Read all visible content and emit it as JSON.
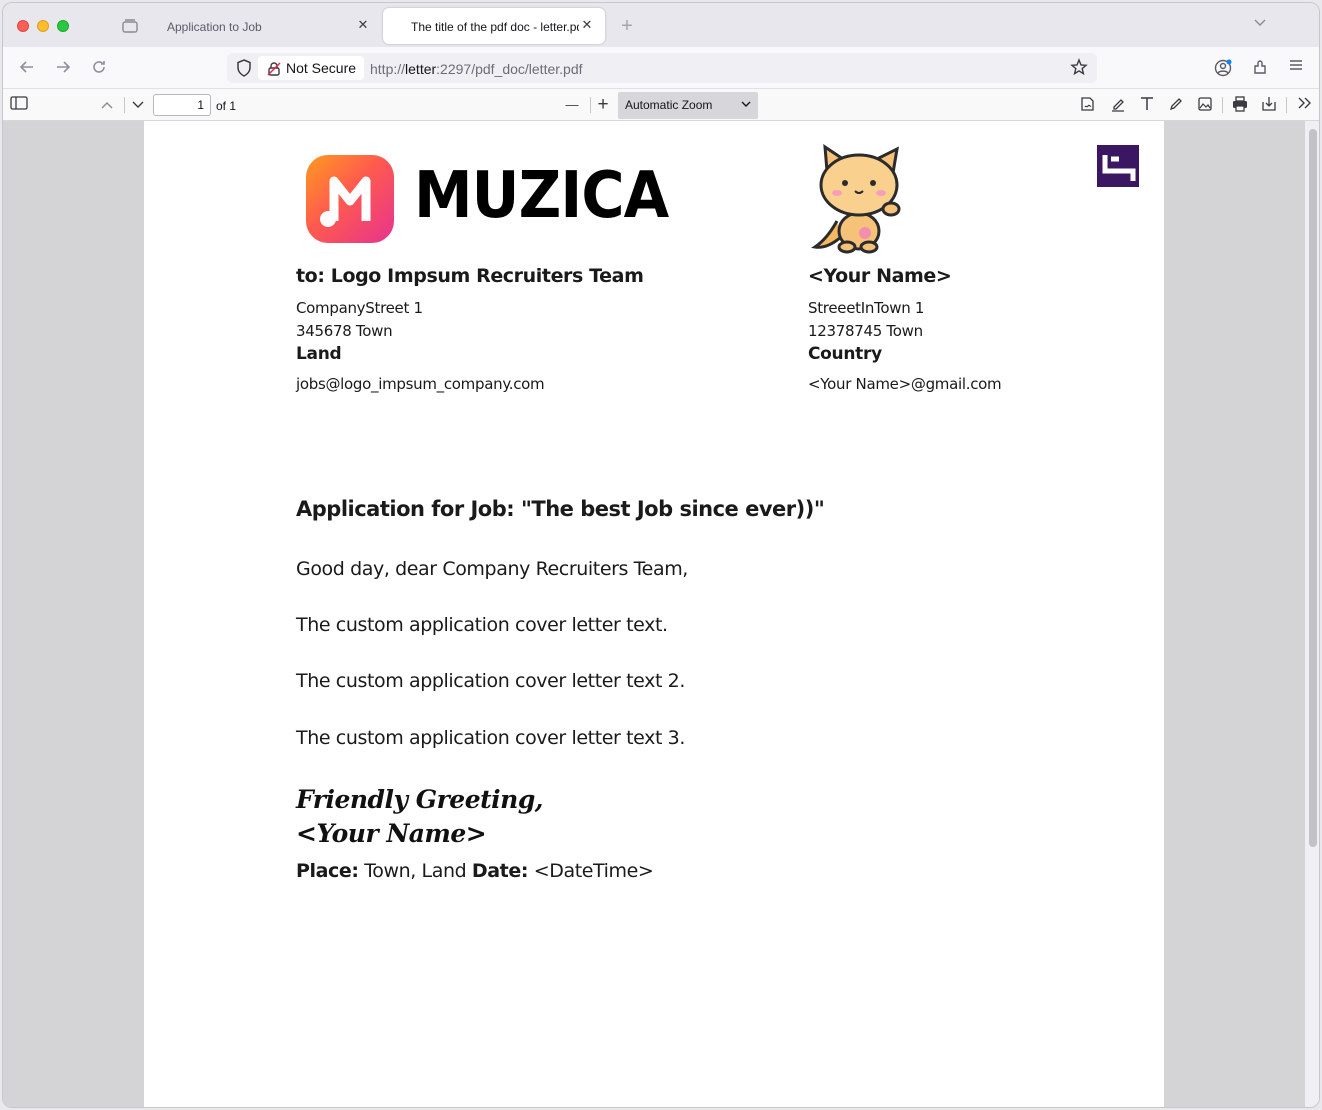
{
  "tabs": [
    {
      "label": "Application to Job",
      "close": "✕"
    },
    {
      "label": "The title of the pdf doc - letter.pdf",
      "close": "✕"
    }
  ],
  "new_tab": "+",
  "address_bar": {
    "security_label": "Not Secure",
    "url_prefix": "http://",
    "url_host": "letter",
    "url_rest": ":2297/pdf_doc/letter.pdf"
  },
  "pdf_toolbar": {
    "page_number": "1",
    "page_count": "of 1",
    "zoom_out": "—",
    "zoom_in": "+",
    "zoom": "Automatic Zoom"
  },
  "document": {
    "logo_text": "MUZICA",
    "recipient": {
      "heading": "to: Logo Impsum Recruiters Team",
      "street": "CompanyStreet 1",
      "city": "345678  Town",
      "country": "Land",
      "email": "jobs@logo_impsum_company.com"
    },
    "sender": {
      "heading": "<Your Name>",
      "street": "StreeetInTown 1",
      "city": "12378745  Town",
      "country": "Country",
      "email": "<Your Name>@gmail.com"
    },
    "subject": "Application for Job: \"The best Job since ever))\"",
    "greeting": "Good day, dear Company Recruiters Team,",
    "paragraphs": [
      "The custom application cover letter text.",
      "The custom application cover letter text 2.",
      "The custom application cover letter text 3."
    ],
    "closing": "Friendly Greeting,",
    "signature": "<Your Name>",
    "place_label": "Place:",
    "place_value": "Town, Land",
    "date_label": "Date:",
    "date_value": "<DateTime>"
  }
}
